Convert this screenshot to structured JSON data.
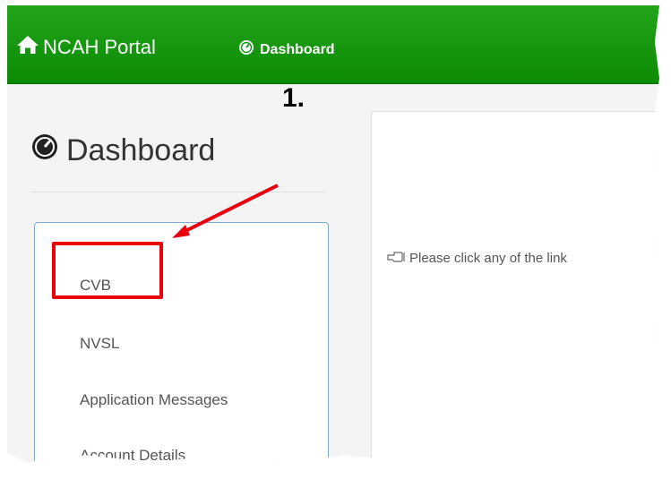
{
  "navbar": {
    "brand": "NCAH Portal",
    "dashboard_link": "Dashboard",
    "color": "#12961a"
  },
  "sidebar": {
    "title": "Dashboard",
    "items": [
      {
        "label": "CVB"
      },
      {
        "label": "NVSL"
      },
      {
        "label": "Application Messages"
      },
      {
        "label": "Account Details"
      }
    ]
  },
  "main": {
    "info_text": "Please click any of the link"
  },
  "annotation": {
    "label": "1.",
    "color": "#e8000d"
  },
  "icons": [
    "home-icon",
    "dashboard-icon",
    "hand-pointer-icon"
  ]
}
